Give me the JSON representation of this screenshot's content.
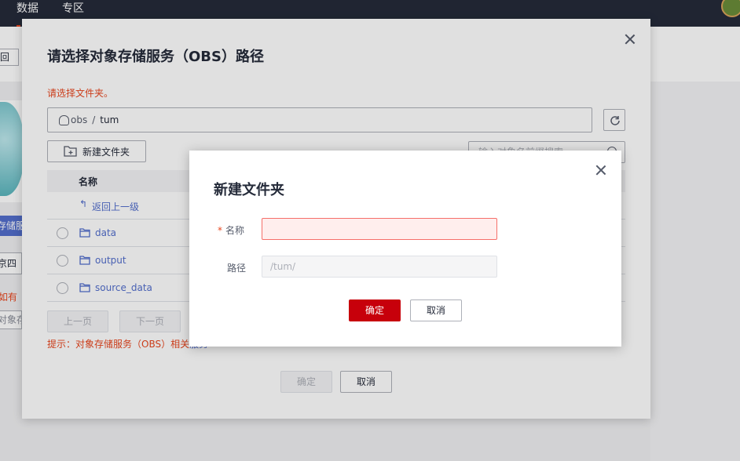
{
  "topbar": {
    "nav": [
      "数据",
      "专区"
    ]
  },
  "background": {
    "back_button": "回",
    "tag": "存储服",
    "select": "京四",
    "warning": "如有",
    "input": "对象存"
  },
  "outer_dialog": {
    "title": "请选择对象存储服务（OBS）路径",
    "hint": "请选择文件夹。",
    "path": {
      "root": "obs",
      "separator": "/",
      "current": "tum"
    },
    "new_folder_label": "新建文件夹",
    "search_placeholder": "输入对象名前缀搜索",
    "table": {
      "header": "名称",
      "back_link": "返回上一级",
      "rows": [
        "data",
        "output",
        "source_data"
      ]
    },
    "pager": {
      "prev": "上一页",
      "next": "下一页"
    },
    "tip_prefix": "提示：对象存储服务（OBS）相关",
    "tip_link": "服务",
    "confirm_label": "确定",
    "cancel_label": "取消"
  },
  "inner_dialog": {
    "title": "新建文件夹",
    "name_label": "名称",
    "required_mark": "*",
    "name_value": "",
    "path_label": "路径",
    "path_value": "/tum/",
    "confirm_label": "确定",
    "cancel_label": "取消"
  },
  "colors": {
    "primary_red": "#c7000b",
    "link_blue": "#526ecc",
    "warning_red": "#e8461e",
    "topbar": "#252b3a"
  }
}
